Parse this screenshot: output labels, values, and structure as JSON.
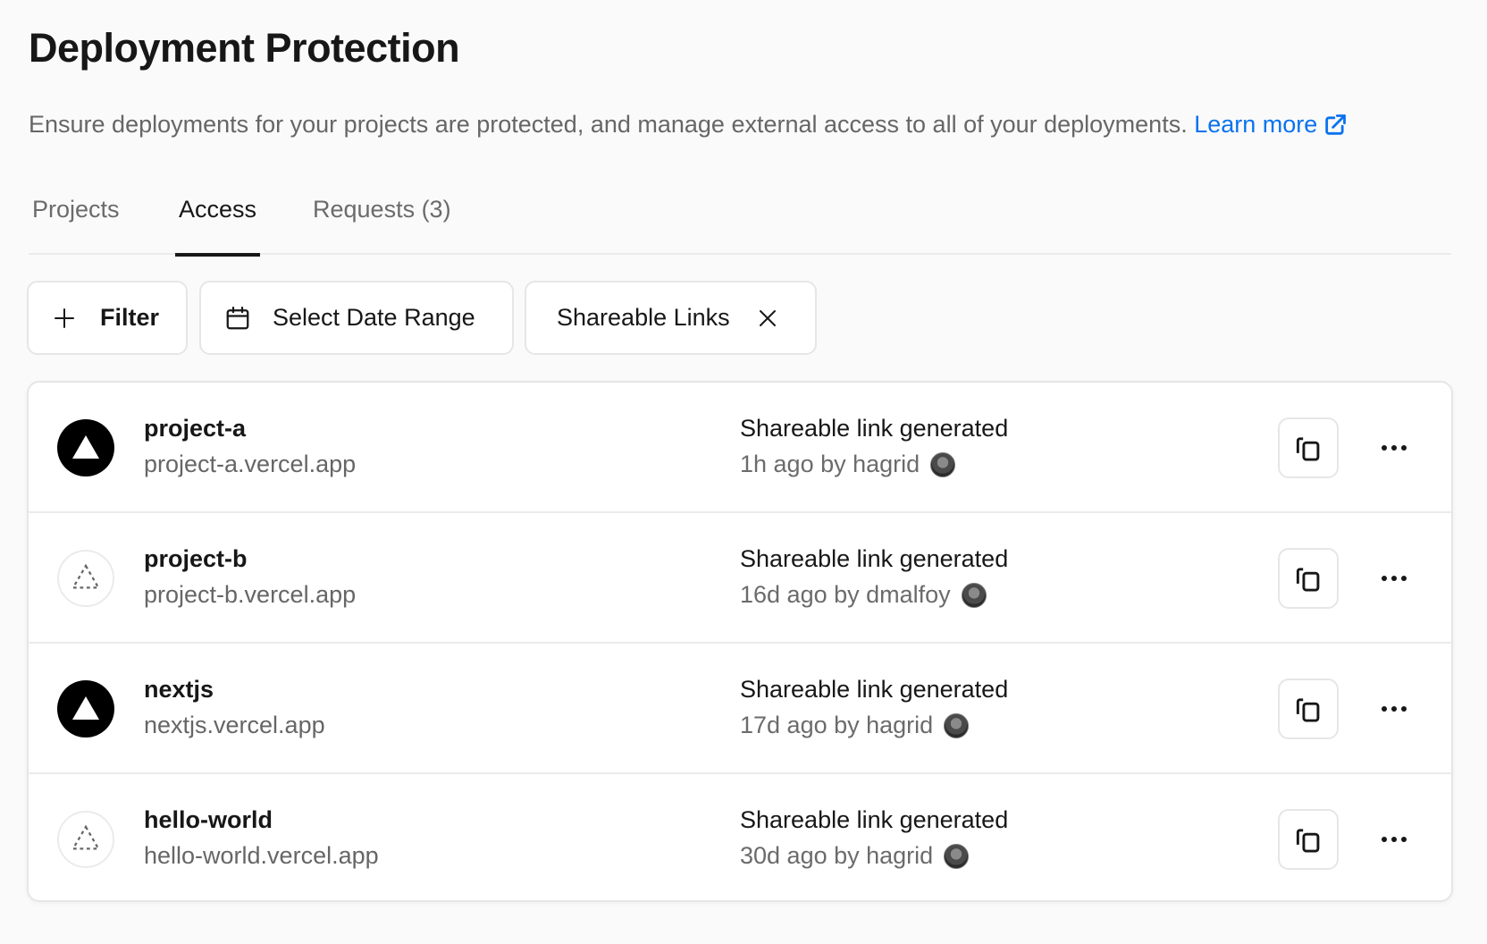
{
  "header": {
    "title": "Deployment Protection",
    "description": "Ensure deployments for your projects are protected, and manage external access to all of your deployments.",
    "learn_more": "Learn more",
    "learn_more_icon": "external-link-icon",
    "link_color": "#0a72ef"
  },
  "tabs": [
    {
      "label": "Projects",
      "active": false
    },
    {
      "label": "Access",
      "active": true
    },
    {
      "label": "Requests (3)",
      "active": false
    }
  ],
  "filters": {
    "filter_label": "Filter",
    "filter_icon": "plus-icon",
    "date_label": "Select Date Range",
    "date_icon": "calendar-icon",
    "active_filter_label": "Shareable Links",
    "active_filter_icon": "close-icon"
  },
  "rows": [
    {
      "name": "project-a",
      "url": "project-a.vercel.app",
      "logo": "solid-triangle-logo",
      "event": "Shareable link generated",
      "meta": "1h ago by hagrid",
      "user": "hagrid"
    },
    {
      "name": "project-b",
      "url": "project-b.vercel.app",
      "logo": "dashed-triangle-logo",
      "event": "Shareable link generated",
      "meta": "16d ago by dmalfoy",
      "user": "dmalfoy"
    },
    {
      "name": "nextjs",
      "url": "nextjs.vercel.app",
      "logo": "solid-triangle-logo",
      "event": "Shareable link generated",
      "meta": "17d ago by hagrid",
      "user": "hagrid"
    },
    {
      "name": "hello-world",
      "url": "hello-world.vercel.app",
      "logo": "dashed-triangle-logo",
      "event": "Shareable link generated",
      "meta": "30d ago by hagrid",
      "user": "hagrid"
    }
  ],
  "row_actions": {
    "copy_icon": "copy-icon",
    "more_icon": "more-horizontal-icon"
  }
}
